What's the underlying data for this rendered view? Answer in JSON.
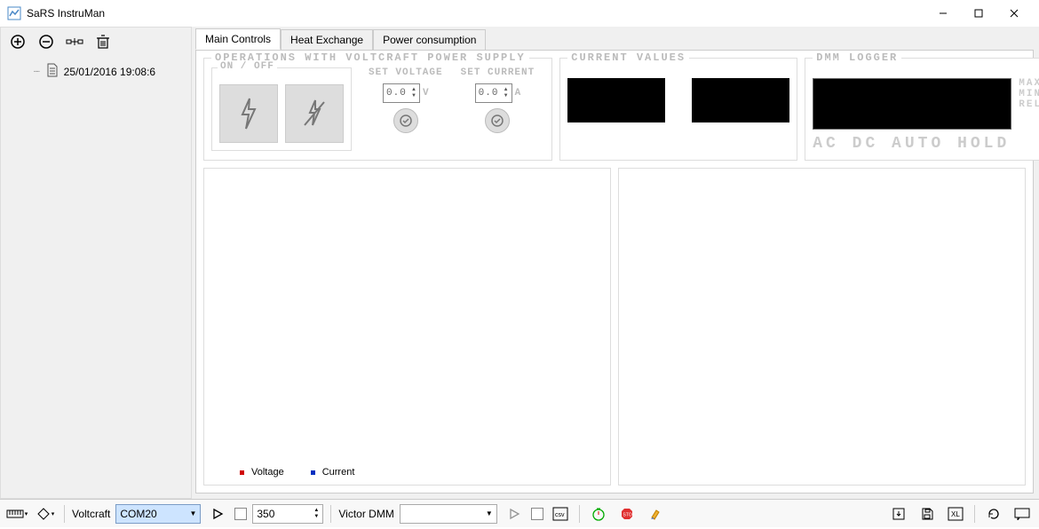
{
  "window": {
    "title": "SaRS InstruMan"
  },
  "tree": {
    "items": [
      {
        "label": "25/01/2016 19:08:6"
      }
    ]
  },
  "tabs": [
    {
      "label": "Main Controls",
      "active": true
    },
    {
      "label": "Heat Exchange",
      "active": false
    },
    {
      "label": "Power consumption",
      "active": false
    }
  ],
  "ps": {
    "title": "OPERATIONS WITH VOLTCRAFT POWER SUPPLY",
    "onoff_title": "ON / OFF",
    "set_voltage_label": "SET VOLTAGE",
    "set_current_label": "SET CURRENT",
    "voltage_value": "0.0",
    "voltage_unit": "V",
    "current_value": "0.0",
    "current_unit": "A"
  },
  "cv": {
    "title": "CURRENT VALUES"
  },
  "dmm": {
    "title": "DMM LOGGER",
    "max": "MAX",
    "min": "MIN",
    "rel": "REL",
    "modes": "AC DC AUTO HOLD"
  },
  "chart": {
    "legend": {
      "voltage": "Voltage",
      "current": "Current"
    },
    "colors": {
      "voltage": "#d00000",
      "current": "#0030c0"
    }
  },
  "status": {
    "voltcraft_label": "Voltcraft",
    "voltcraft_port": "COM20",
    "interval": "350",
    "victor_label": "Victor DMM",
    "victor_port": ""
  }
}
